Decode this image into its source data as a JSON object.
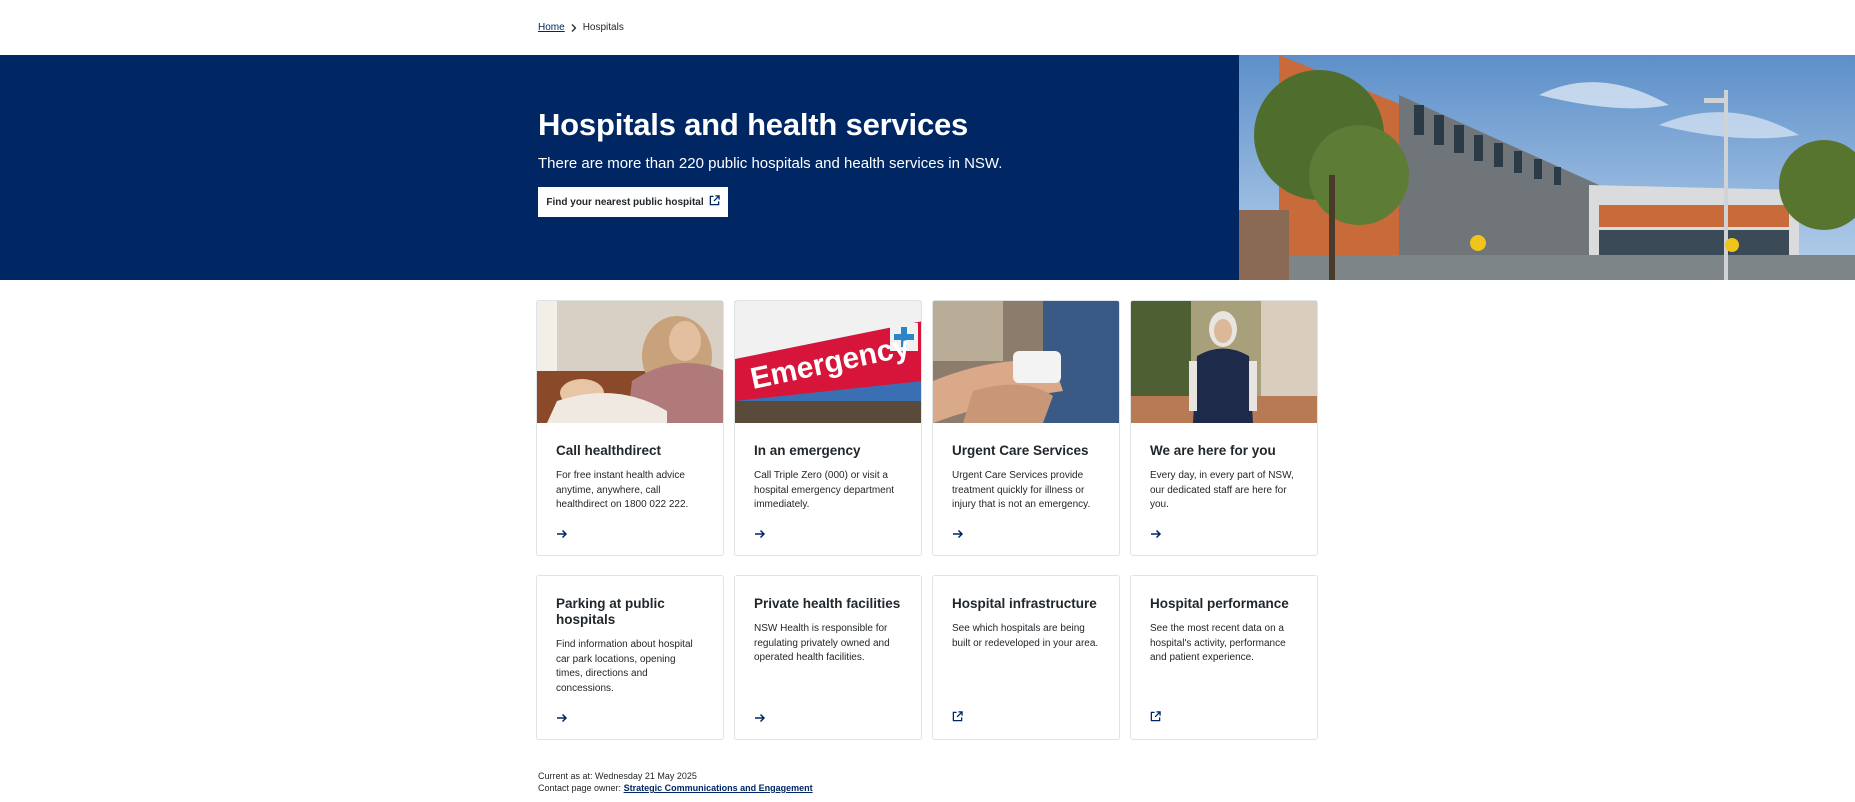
{
  "breadcrumb": {
    "home": "Home",
    "current": "Hospitals"
  },
  "hero": {
    "title": "Hospitals and health services",
    "subtitle": "There are more than 220 public hospitals and health services in NSW.",
    "button_label": "Find your nearest public hospital"
  },
  "cards": [
    {
      "title": "Call healthdirect",
      "text": "For free instant health advice anytime, anywhere, call healthdirect on 1800 022 222.",
      "icon": "arrow-right-icon"
    },
    {
      "title": "In an emergency",
      "text": "Call Triple Zero (000) or visit a hospital emergency department immediately.",
      "icon": "arrow-right-icon",
      "sign_text": "Emergency"
    },
    {
      "title": "Urgent Care Services",
      "text": "Urgent Care Services provide treatment quickly for illness or injury that is not an emergency.",
      "icon": "arrow-right-icon"
    },
    {
      "title": "We are here for you",
      "text": "Every day, in every part of NSW, our dedicated staff are here for you.",
      "icon": "arrow-right-icon"
    },
    {
      "title": "Parking at public hospitals",
      "text": "Find information about hospital car park locations, opening times, directions and concessions.",
      "icon": "arrow-right-icon"
    },
    {
      "title": "Private health facilities",
      "text": "NSW Health is responsible for regulating privately owned and operated health facilities.",
      "icon": "arrow-right-icon"
    },
    {
      "title": "Hospital infrastructure",
      "text": "See which hospitals are being built or redeveloped in your area.",
      "icon": "external-link-icon"
    },
    {
      "title": "Hospital performance",
      "text": "See the most recent data on a hospital's activity, performance and patient experience.",
      "icon": "external-link-icon"
    }
  ],
  "meta": {
    "current_as_at": "Current as at: Wednesday 21 May 2025",
    "owner_label": "Contact page owner:",
    "owner_link": "Strategic Communications and Engagement"
  },
  "colors": {
    "brand_navy": "#002664",
    "emergency_red": "#d7153a",
    "text": "#22272b",
    "border": "#dee3e5"
  }
}
